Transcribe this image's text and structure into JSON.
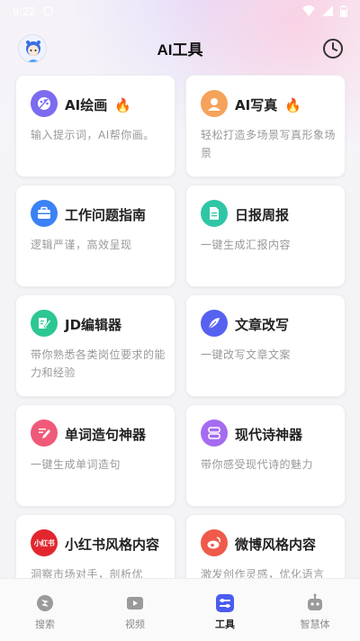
{
  "status": {
    "time": "9:22"
  },
  "header": {
    "title": "AI工具"
  },
  "cards": [
    {
      "title": "AI绘画",
      "hot": "🔥",
      "desc": "输入提示词，AI帮你画。",
      "icon": "palette-icon",
      "color": "#7b6cf0"
    },
    {
      "title": "AI写真",
      "hot": "🔥",
      "desc": "轻松打造多场景写真形象场景",
      "icon": "portrait-icon",
      "color": "#f5a25b"
    },
    {
      "title": "工作问题指南",
      "desc": "逻辑严谨，高效呈现",
      "icon": "briefcase-icon",
      "color": "#3b82f6"
    },
    {
      "title": "日报周报",
      "desc": "一键生成汇报内容",
      "icon": "document-icon",
      "color": "#2fc6a6"
    },
    {
      "title": "JD编辑器",
      "desc": "带你熟悉各类岗位要求的能力和经验",
      "icon": "edit-icon",
      "color": "#2cc792"
    },
    {
      "title": "文章改写",
      "desc": "一键改写文章文案",
      "icon": "feather-icon",
      "color": "#5661f0"
    },
    {
      "title": "单词造句神器",
      "desc": "一键生成单词造句",
      "icon": "pencil-icon",
      "color": "#f05a7a"
    },
    {
      "title": "现代诗神器",
      "desc": "带你感受现代诗的魅力",
      "icon": "poem-icon",
      "color": "#a66cf0"
    },
    {
      "title": "小红书风格内容",
      "desc": "洞察市场对手，剖析优",
      "icon": "xiaohongshu-icon",
      "color": "#e2262f",
      "badge": "小红书"
    },
    {
      "title": "微博风格内容",
      "desc": "激发创作灵感，优化语言",
      "icon": "weibo-icon",
      "color": "#f05a4a"
    }
  ],
  "tabs": [
    {
      "label": "搜索",
      "icon": "search-tab-icon"
    },
    {
      "label": "视频",
      "icon": "video-tab-icon"
    },
    {
      "label": "工具",
      "icon": "tools-tab-icon",
      "active": true
    },
    {
      "label": "智慧体",
      "icon": "robot-tab-icon"
    }
  ]
}
